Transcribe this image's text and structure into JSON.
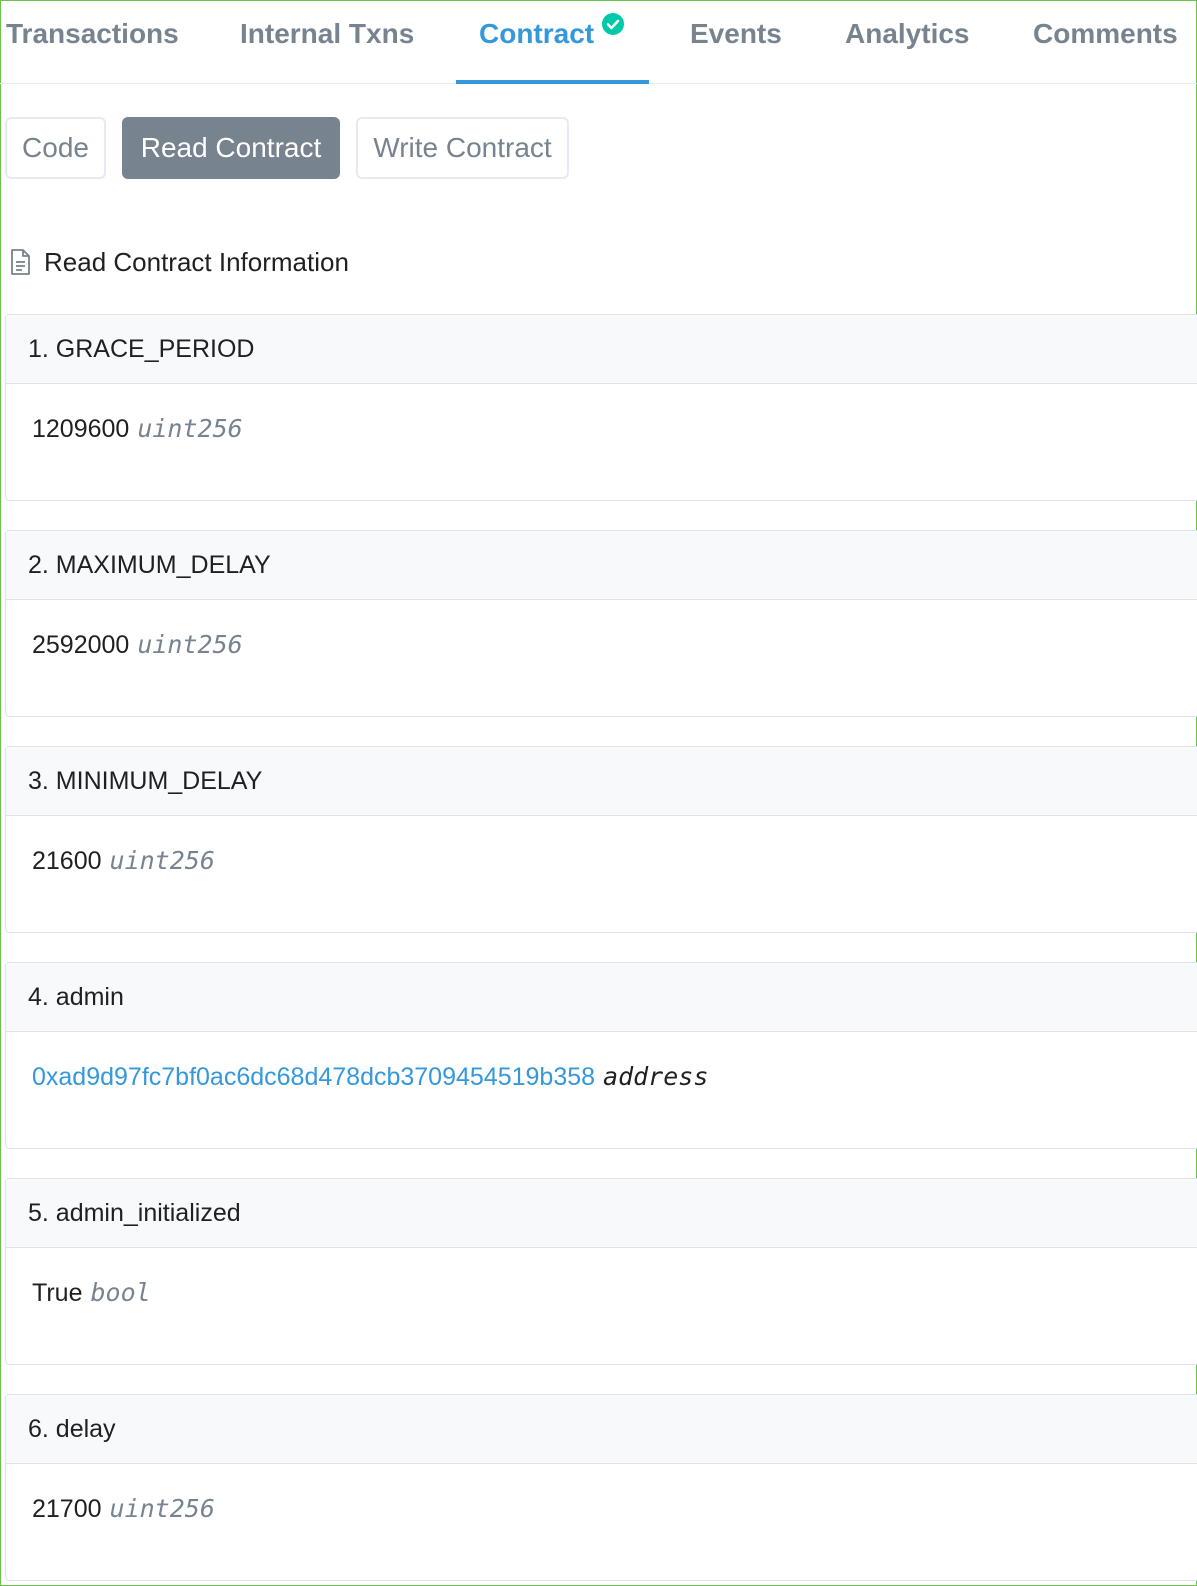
{
  "tabs": {
    "transactions": "Transactions",
    "internal_txns": "Internal Txns",
    "contract": "Contract",
    "events": "Events",
    "analytics": "Analytics",
    "comments": "Comments"
  },
  "subtabs": {
    "code": "Code",
    "read_contract": "Read Contract",
    "write_contract": "Write Contract"
  },
  "section_title": "Read Contract Information",
  "functions": [
    {
      "label": "1. GRACE_PERIOD",
      "value": "1209600",
      "type": "uint256"
    },
    {
      "label": "2. MAXIMUM_DELAY",
      "value": "2592000",
      "type": "uint256"
    },
    {
      "label": "3. MINIMUM_DELAY",
      "value": "21600",
      "type": "uint256"
    },
    {
      "label": "4. admin",
      "value": "0xad9d97fc7bf0ac6dc68d478dcb3709454519b358",
      "type": "address"
    },
    {
      "label": "5. admin_initialized",
      "value": "True",
      "type": "bool"
    },
    {
      "label": "6. delay",
      "value": "21700",
      "type": "uint256"
    }
  ],
  "colors": {
    "accent": "#3498db",
    "verified": "#00c9a7",
    "muted": "#77838f",
    "frame": "#6cc24a"
  }
}
